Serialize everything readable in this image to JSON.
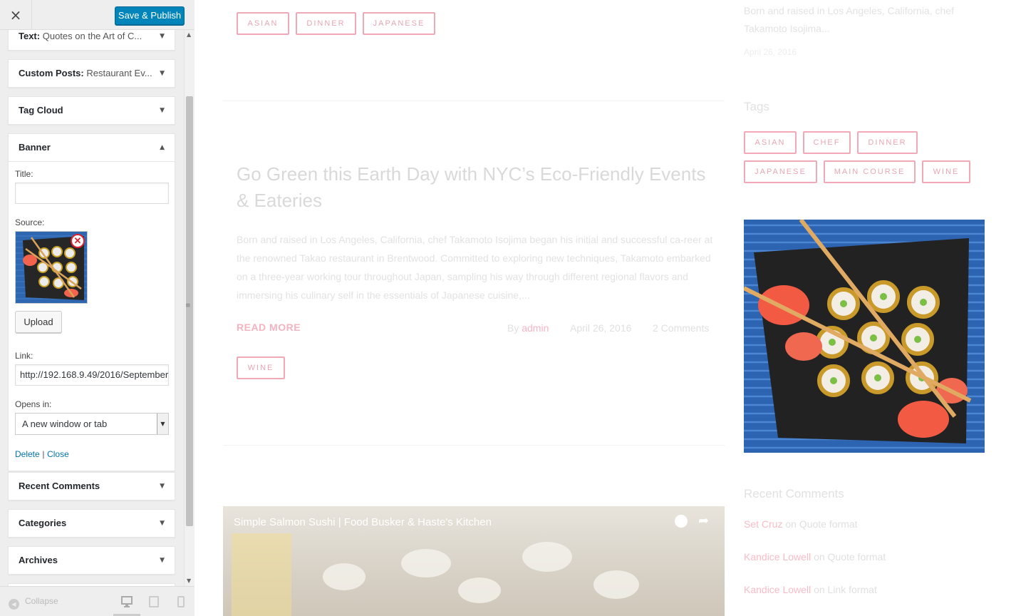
{
  "sidebar": {
    "close_icon": "×",
    "save_label": "Save & Publish",
    "widgets": [
      {
        "type": "Text:",
        "title": "Quotes on the Art of C..."
      },
      {
        "type": "Custom Posts:",
        "title": "Restaurant Ev..."
      },
      {
        "type": "Tag Cloud",
        "title": ""
      },
      {
        "type": "Banner",
        "title": ""
      },
      {
        "type": "Recent Comments",
        "title": ""
      },
      {
        "type": "Categories",
        "title": ""
      },
      {
        "type": "Archives",
        "title": ""
      }
    ],
    "banner_form": {
      "title_label": "Title:",
      "title_value": "",
      "source_label": "Source:",
      "upload_label": "Upload",
      "link_label": "Link:",
      "link_value": "http://192.168.9.49/2016/September",
      "opens_label": "Opens in:",
      "opens_value": "A new window or tab",
      "delete_label": "Delete",
      "separator": "|",
      "close_label": "Close"
    },
    "footer": {
      "collapse_label": "Collapse"
    }
  },
  "preview": {
    "top_tags": [
      "ASIAN",
      "DINNER",
      "JAPANESE"
    ],
    "post": {
      "title": "Go Green this Earth Day with NYC’s Eco-Friendly Events & Eateries",
      "excerpt": "Born and raised in Los Angeles, California, chef Takamoto Isojima began his initial and successful ca-reer at the renowned Takao restaurant in Brentwood. Committed to exploring new techniques, Takamoto embarked on a three-year working tour throughout Japan, sampling his way through different regional flavors and immersing his culinary self in the essentials of Japanese cuisine,...",
      "read_more": "READ MORE",
      "by": "By",
      "author": "admin",
      "date": "April 26, 2016",
      "comments": "2 Comments",
      "tags": [
        "WINE"
      ]
    },
    "video": {
      "title": "Simple Salmon Sushi | Food Busker & Haste's Kitchen"
    },
    "right": {
      "intro_text": "Born and raised in Los Angeles, California, chef Takamoto Isojima...",
      "intro_date": "April 26, 2016",
      "tags_title": "Tags",
      "tags": [
        "ASIAN",
        "CHEF",
        "DINNER",
        "JAPANESE",
        "MAIN COURSE",
        "WINE"
      ],
      "recent_comments_title": "Recent Comments",
      "comments": [
        {
          "author": "Set Cruz",
          "on": "on",
          "post": "Quote format"
        },
        {
          "author": "Kandice Lowell",
          "on": "on",
          "post": "Quote format"
        },
        {
          "author": "Kandice Lowell",
          "on": "on",
          "post": "Link format"
        }
      ]
    }
  },
  "colors": {
    "primary_button": "#0085ba",
    "tag_pink": "#f2a9b7",
    "link_blue": "#0073aa"
  }
}
